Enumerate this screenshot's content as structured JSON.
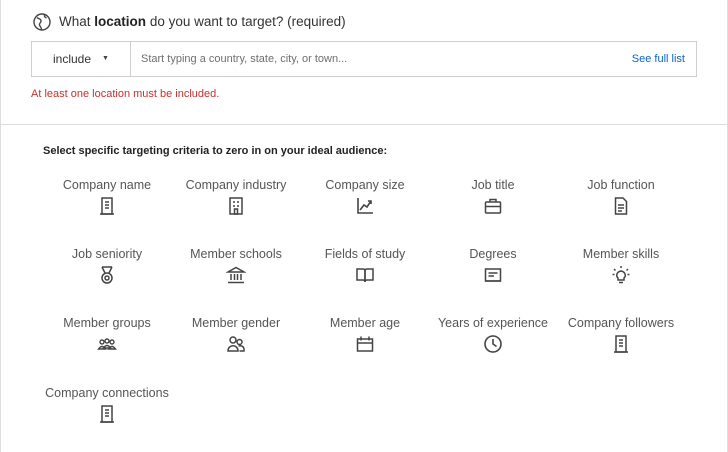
{
  "location": {
    "question_prefix": "What",
    "question_bold": "location",
    "question_suffix": "do you want to target? (required)",
    "include_value": "include",
    "input_placeholder": "Start typing a country, state, city, or town...",
    "see_full_list": "See full list",
    "error": "At least one location must be included."
  },
  "criteria": {
    "intro": "Select specific targeting criteria to zero in on your ideal audience:",
    "items": [
      {
        "label": "Company name",
        "icon": "building-icon"
      },
      {
        "label": "Company industry",
        "icon": "industry-icon"
      },
      {
        "label": "Company size",
        "icon": "chart-growth-icon"
      },
      {
        "label": "Job title",
        "icon": "briefcase-icon"
      },
      {
        "label": "Job function",
        "icon": "document-icon"
      },
      {
        "label": "Job seniority",
        "icon": "medal-icon"
      },
      {
        "label": "Member schools",
        "icon": "school-icon"
      },
      {
        "label": "Fields of study",
        "icon": "book-icon"
      },
      {
        "label": "Degrees",
        "icon": "diploma-icon"
      },
      {
        "label": "Member skills",
        "icon": "lightbulb-icon"
      },
      {
        "label": "Member groups",
        "icon": "group-icon"
      },
      {
        "label": "Member gender",
        "icon": "people-icon"
      },
      {
        "label": "Member age",
        "icon": "calendar-icon"
      },
      {
        "label": "Years of experience",
        "icon": "clock-icon"
      },
      {
        "label": "Company followers",
        "icon": "building-icon"
      },
      {
        "label": "Company connections",
        "icon": "building-icon"
      }
    ]
  },
  "colors": {
    "link": "#0a66c2",
    "error": "#c7302b",
    "icon": "#444444"
  }
}
